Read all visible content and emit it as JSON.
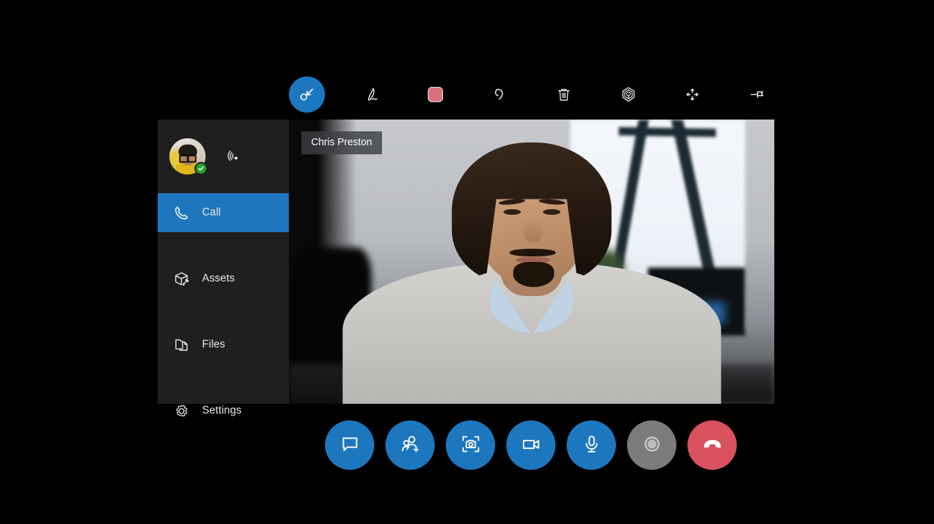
{
  "toolbar": {
    "tools": [
      {
        "name": "select-tool",
        "label": "Select",
        "icon": "cursor-select-icon",
        "active": true
      },
      {
        "name": "ink-tool",
        "label": "Ink",
        "icon": "pen-icon",
        "active": false
      },
      {
        "name": "color-swatch",
        "label": "Color",
        "icon": "color-swatch-icon",
        "active": false,
        "color": "#d9727c"
      },
      {
        "name": "undo-tool",
        "label": "Undo",
        "icon": "undo-arrow-icon",
        "active": false
      },
      {
        "name": "delete-tool",
        "label": "Delete",
        "icon": "trash-icon",
        "active": false
      },
      {
        "name": "place-marker-tool",
        "label": "Place Marker",
        "icon": "location-pin-icon",
        "active": false
      },
      {
        "name": "move-tool",
        "label": "Move",
        "icon": "move-arrows-icon",
        "active": false
      },
      {
        "name": "pin-tool",
        "label": "Pin",
        "icon": "pushpin-icon",
        "active": false
      }
    ]
  },
  "sidebar": {
    "profile": {
      "avatar_alt": "User avatar",
      "presence": "available",
      "presence_icon": "check-badge-icon",
      "connection_icon": "wifi-signal-icon"
    },
    "items": [
      {
        "label": "Call",
        "icon": "phone-icon",
        "active": true
      },
      {
        "label": "Assets",
        "icon": "box-3d-icon",
        "active": false
      },
      {
        "label": "Files",
        "icon": "files-icon",
        "active": false
      },
      {
        "label": "Settings",
        "icon": "gear-icon",
        "active": false
      }
    ]
  },
  "video": {
    "participant_name": "Chris Preston"
  },
  "controls": [
    {
      "name": "chat-button",
      "label": "Chat",
      "icon": "chat-bubble-icon",
      "style": "blue"
    },
    {
      "name": "add-people-button",
      "label": "Add People",
      "icon": "person-add-icon",
      "style": "blue"
    },
    {
      "name": "capture-button",
      "label": "Capture",
      "icon": "camera-frame-icon",
      "style": "blue"
    },
    {
      "name": "video-button",
      "label": "Video",
      "icon": "video-camera-icon",
      "style": "blue"
    },
    {
      "name": "microphone-button",
      "label": "Microphone",
      "icon": "microphone-icon",
      "style": "blue"
    },
    {
      "name": "record-button",
      "label": "Record",
      "icon": "record-dot-icon",
      "style": "gray"
    },
    {
      "name": "end-call-button",
      "label": "End Call",
      "icon": "hang-up-icon",
      "style": "red"
    }
  ],
  "colors": {
    "accent_blue": "#1d77bf",
    "end_call_red": "#d9505e",
    "record_gray": "#7b7b7b",
    "sidebar_bg": "#1f1f1f",
    "page_bg": "#000000",
    "swatch_pink": "#d9727c"
  }
}
